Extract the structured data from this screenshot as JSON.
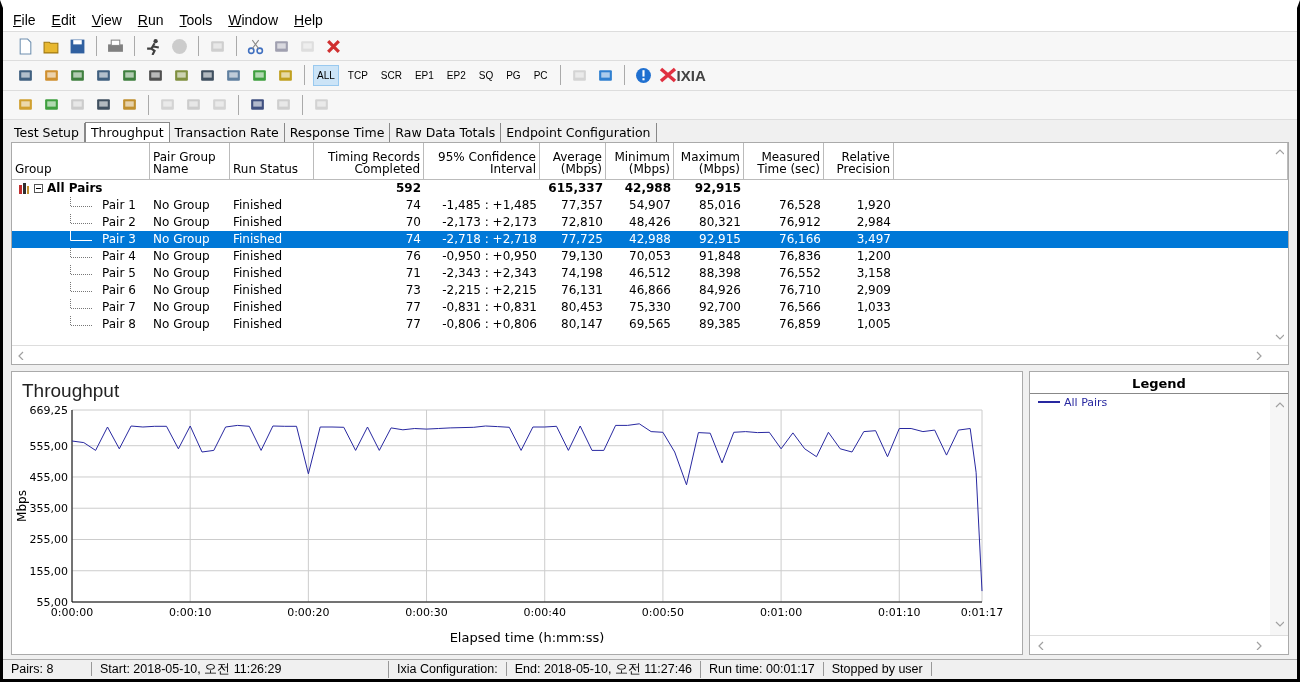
{
  "menu": [
    {
      "label": "File"
    },
    {
      "label": "Edit"
    },
    {
      "label": "View"
    },
    {
      "label": "Run"
    },
    {
      "label": "Tools"
    },
    {
      "label": "Window"
    },
    {
      "label": "Help"
    }
  ],
  "toolbars": [
    {
      "items": [
        {
          "kind": "icon",
          "disabled": false
        },
        {
          "kind": "icon",
          "disabled": false
        },
        {
          "kind": "icon",
          "disabled": false
        },
        {
          "kind": "separator"
        },
        {
          "kind": "icon",
          "disabled": false
        },
        {
          "kind": "separator"
        },
        {
          "kind": "icon",
          "disabled": false
        },
        {
          "kind": "icon",
          "disabled": true
        },
        {
          "kind": "separator"
        },
        {
          "kind": "icon",
          "disabled": true
        },
        {
          "kind": "separator"
        },
        {
          "kind": "icon",
          "disabled": false
        },
        {
          "kind": "icon",
          "disabled": false
        },
        {
          "kind": "icon",
          "disabled": true
        },
        {
          "kind": "icon",
          "disabled": false
        }
      ]
    },
    {
      "items": [
        {
          "kind": "icon",
          "disabled": false
        },
        {
          "kind": "icon",
          "disabled": false
        },
        {
          "kind": "icon",
          "disabled": false
        },
        {
          "kind": "icon",
          "disabled": false
        },
        {
          "kind": "icon",
          "disabled": false
        },
        {
          "kind": "icon",
          "disabled": false
        },
        {
          "kind": "icon",
          "disabled": false
        },
        {
          "kind": "icon",
          "disabled": false
        },
        {
          "kind": "icon",
          "disabled": false
        },
        {
          "kind": "icon",
          "disabled": false
        },
        {
          "kind": "icon",
          "disabled": false
        },
        {
          "kind": "separator"
        },
        {
          "kind": "text",
          "label": "ALL",
          "selected": true
        },
        {
          "kind": "text",
          "label": "TCP",
          "selected": false
        },
        {
          "kind": "text",
          "label": "SCR",
          "selected": false
        },
        {
          "kind": "text",
          "label": "EP1",
          "selected": false
        },
        {
          "kind": "text",
          "label": "EP2",
          "selected": false
        },
        {
          "kind": "text",
          "label": "SQ",
          "selected": false
        },
        {
          "kind": "text",
          "label": "PG",
          "selected": false
        },
        {
          "kind": "text",
          "label": "PC",
          "selected": false
        },
        {
          "kind": "separator"
        },
        {
          "kind": "icon",
          "disabled": true
        },
        {
          "kind": "icon",
          "disabled": false
        },
        {
          "kind": "separator"
        },
        {
          "kind": "icon",
          "disabled": false
        },
        {
          "kind": "logo",
          "label": "IXIA"
        }
      ]
    },
    {
      "items": [
        {
          "kind": "icon",
          "disabled": false
        },
        {
          "kind": "icon",
          "disabled": false
        },
        {
          "kind": "icon",
          "disabled": true
        },
        {
          "kind": "icon",
          "disabled": false
        },
        {
          "kind": "icon",
          "disabled": false
        },
        {
          "kind": "separator"
        },
        {
          "kind": "icon",
          "disabled": true
        },
        {
          "kind": "icon",
          "disabled": true
        },
        {
          "kind": "icon",
          "disabled": true
        },
        {
          "kind": "separator"
        },
        {
          "kind": "icon",
          "disabled": false
        },
        {
          "kind": "icon",
          "disabled": true
        },
        {
          "kind": "separator"
        },
        {
          "kind": "icon",
          "disabled": true
        }
      ]
    }
  ],
  "tabs": [
    {
      "label": "Test Setup",
      "selected": false
    },
    {
      "label": "Throughput",
      "selected": true
    },
    {
      "label": "Transaction Rate",
      "selected": false
    },
    {
      "label": "Response Time",
      "selected": false
    },
    {
      "label": "Raw Data Totals",
      "selected": false
    },
    {
      "label": "Endpoint Configuration",
      "selected": false
    }
  ],
  "table": {
    "columns": [
      "Group",
      "Pair Group\nName",
      "Run Status",
      "Timing Records\nCompleted",
      "95% Confidence\nInterval",
      "Average\n(Mbps)",
      "Minimum\n(Mbps)",
      "Maximum\n(Mbps)",
      "Measured\nTime (sec)",
      "Relative\nPrecision"
    ],
    "rows": [
      {
        "cells": [
          "All Pairs",
          null,
          null,
          "592",
          null,
          "615,337",
          "42,988",
          "92,915",
          null,
          null
        ],
        "expanded": true,
        "selected": false,
        "children": [
          {
            "cells": [
              "Pair 1",
              "No Group",
              "Finished",
              "74",
              "-1,485 : +1,485",
              "77,357",
              "54,907",
              "85,016",
              "76,528",
              "1,920"
            ],
            "selected": false
          },
          {
            "cells": [
              "Pair 2",
              "No Group",
              "Finished",
              "70",
              "-2,173 : +2,173",
              "72,810",
              "48,426",
              "80,321",
              "76,912",
              "2,984"
            ],
            "selected": false
          },
          {
            "cells": [
              "Pair 3",
              "No Group",
              "Finished",
              "74",
              "-2,718 : +2,718",
              "77,725",
              "42,988",
              "92,915",
              "76,166",
              "3,497"
            ],
            "selected": true
          },
          {
            "cells": [
              "Pair 4",
              "No Group",
              "Finished",
              "76",
              "-0,950 : +0,950",
              "79,130",
              "70,053",
              "91,848",
              "76,836",
              "1,200"
            ],
            "selected": false
          },
          {
            "cells": [
              "Pair 5",
              "No Group",
              "Finished",
              "71",
              "-2,343 : +2,343",
              "74,198",
              "46,512",
              "88,398",
              "76,552",
              "3,158"
            ],
            "selected": false
          },
          {
            "cells": [
              "Pair 6",
              "No Group",
              "Finished",
              "73",
              "-2,215 : +2,215",
              "76,131",
              "46,866",
              "84,926",
              "76,710",
              "2,909"
            ],
            "selected": false
          },
          {
            "cells": [
              "Pair 7",
              "No Group",
              "Finished",
              "77",
              "-0,831 : +0,831",
              "80,453",
              "75,330",
              "92,700",
              "76,566",
              "1,033"
            ],
            "selected": false
          },
          {
            "cells": [
              "Pair 8",
              "No Group",
              "Finished",
              "77",
              "-0,806 : +0,806",
              "80,147",
              "69,565",
              "89,385",
              "76,859",
              "1,005"
            ],
            "selected": false
          }
        ]
      }
    ]
  },
  "chart": {
    "chart_data": {
      "type": "line",
      "title": "Throughput",
      "xlabel": "Elapsed time (h:mm:ss)",
      "ylabel": "Mbps",
      "x": [
        0,
        1,
        2,
        3,
        4,
        5,
        6,
        7,
        8,
        9,
        10,
        11,
        12,
        13,
        14,
        15,
        16,
        17,
        18,
        19,
        20,
        21,
        22,
        23,
        24,
        25,
        26,
        27,
        28,
        29,
        30,
        31,
        32,
        33,
        34,
        35,
        36,
        37,
        38,
        39,
        40,
        41,
        42,
        43,
        44,
        45,
        46,
        47,
        48,
        49,
        50,
        51,
        52,
        53,
        54,
        55,
        56,
        57,
        58,
        59,
        60,
        61,
        62,
        63,
        64,
        65,
        66,
        67,
        68,
        69,
        70,
        71,
        72,
        73,
        74,
        75,
        76,
        76.5,
        77
      ],
      "series": [
        {
          "name": "All Pairs",
          "color": "#2828a0",
          "values": [
            570,
            565,
            540,
            615,
            545,
            618,
            615,
            617,
            617,
            545,
            618,
            535,
            540,
            615,
            620,
            617,
            540,
            618,
            617,
            617,
            465,
            615,
            615,
            614,
            540,
            615,
            540,
            612,
            606,
            610,
            608,
            610,
            612,
            613,
            614,
            618,
            616,
            614,
            540,
            615,
            615,
            617,
            540,
            618,
            540,
            540,
            620,
            620,
            625,
            600,
            598,
            535,
            430,
            597,
            595,
            500,
            598,
            600,
            597,
            598,
            545,
            596,
            545,
            520,
            598,
            545,
            535,
            600,
            603,
            520,
            610,
            610,
            600,
            605,
            525,
            605,
            610,
            470,
            90
          ]
        }
      ],
      "grid": true,
      "xlim": [
        0,
        77
      ],
      "ylim": [
        55,
        669.25
      ],
      "xticks": [
        {
          "value": 0,
          "label": "0:00:00"
        },
        {
          "value": 10,
          "label": "0:00:10"
        },
        {
          "value": 20,
          "label": "0:00:20"
        },
        {
          "value": 30,
          "label": "0:00:30"
        },
        {
          "value": 40,
          "label": "0:00:40"
        },
        {
          "value": 50,
          "label": "0:00:50"
        },
        {
          "value": 60,
          "label": "0:01:00"
        },
        {
          "value": 70,
          "label": "0:01:10"
        },
        {
          "value": 77,
          "label": "0:01:17"
        }
      ],
      "yticks": [
        {
          "value": 55,
          "label": "55,00"
        },
        {
          "value": 155,
          "label": "155,00"
        },
        {
          "value": 255,
          "label": "255,00"
        },
        {
          "value": 355,
          "label": "355,00"
        },
        {
          "value": 455,
          "label": "455,00"
        },
        {
          "value": 555,
          "label": "555,00"
        },
        {
          "value": 669.25,
          "label": "669,25"
        }
      ]
    }
  },
  "legend": {
    "title": "Legend"
  },
  "status_bar": [
    "Pairs: 8",
    "Start: 2018-05-10, 오전 11:26:29",
    "Ixia Configuration:",
    "End: 2018-05-10, 오전 11:27:46",
    "Run time: 00:01:17",
    "Stopped by user"
  ]
}
